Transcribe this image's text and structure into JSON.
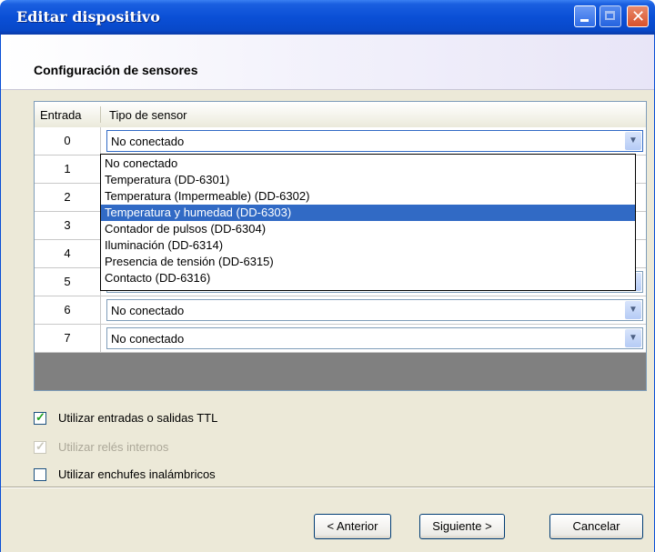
{
  "window": {
    "title": "Editar dispositivo",
    "header": "Configuración de sensores"
  },
  "table": {
    "columns": [
      "Entrada",
      "Tipo de sensor"
    ],
    "rows": [
      {
        "entrada": "0",
        "tipo": "No conectado"
      },
      {
        "entrada": "1",
        "tipo": ""
      },
      {
        "entrada": "2",
        "tipo": ""
      },
      {
        "entrada": "3",
        "tipo": ""
      },
      {
        "entrada": "4",
        "tipo": ""
      },
      {
        "entrada": "5",
        "tipo": ""
      },
      {
        "entrada": "6",
        "tipo": "No conectado"
      },
      {
        "entrada": "7",
        "tipo": "No conectado"
      }
    ]
  },
  "dropdown": {
    "options": [
      "No conectado",
      "Temperatura (DD-6301)",
      "Temperatura (Impermeable) (DD-6302)",
      "Temperatura y humedad (DD-6303)",
      "Contador de pulsos (DD-6304)",
      "Iluminación (DD-6314)",
      "Presencia de tensión (DD-6315)",
      "Contacto (DD-6316)"
    ],
    "highlighted": "Temperatura y humedad (DD-6303)"
  },
  "options": {
    "ttl_label": "Utilizar entradas o salidas TTL",
    "ttl_checked": true,
    "relays_label": "Utilizar relés internos",
    "relays_checked": true,
    "relays_enabled": false,
    "wireless_label": "Utilizar enchufes inalámbricos",
    "wireless_checked": false
  },
  "buttons": {
    "back": "< Anterior",
    "next": "Siguiente >",
    "cancel": "Cancelar"
  },
  "colors": {
    "titlebar": "#0a4fd6",
    "selection": "#316ac5",
    "window_bg": "#ece9d8",
    "check_mark": "#21a121"
  }
}
